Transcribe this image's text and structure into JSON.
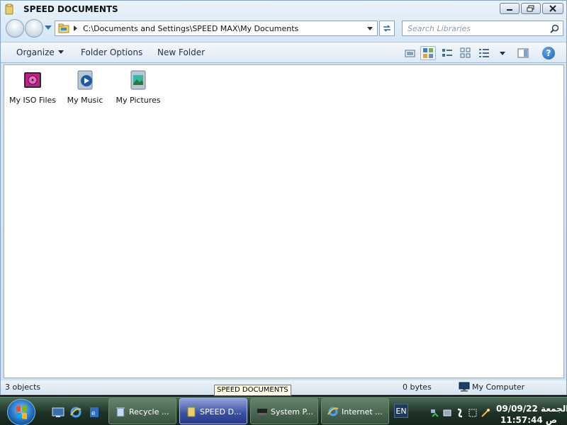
{
  "window": {
    "title": "SPEED DOCUMENTS",
    "address_path": "C:\\Documents and Settings\\SPEED MAX\\My Documents",
    "search_placeholder": "Search Libraries"
  },
  "toolbar": {
    "organize_label": "Organize",
    "folder_options_label": "Folder Options",
    "new_folder_label": "New Folder"
  },
  "items": [
    {
      "label": "My ISO Files",
      "icon": "iso-folder-icon"
    },
    {
      "label": "My Music",
      "icon": "music-folder-icon"
    },
    {
      "label": "My Pictures",
      "icon": "pictures-folder-icon"
    }
  ],
  "status": {
    "object_count": "3 objects",
    "size": "0 bytes",
    "location": "My Computer"
  },
  "tooltip": "SPEED DOCUMENTS",
  "taskbar": {
    "buttons": [
      {
        "label": "Recycle ...",
        "icon": "recycle-bin-icon"
      },
      {
        "label": "SPEED D...",
        "icon": "folder-icon"
      },
      {
        "label": "System P...",
        "icon": "system-properties-icon"
      },
      {
        "label": "Internet ...",
        "icon": "internet-explorer-icon"
      }
    ],
    "language": "EN",
    "clock_date": "الجمعة 09/09/22",
    "clock_time": "ص 11:57:44"
  },
  "colors": {
    "taskbar": "#1e3327",
    "active_task": "#3b4fa2",
    "window_chrome": "#d4e6f5"
  }
}
